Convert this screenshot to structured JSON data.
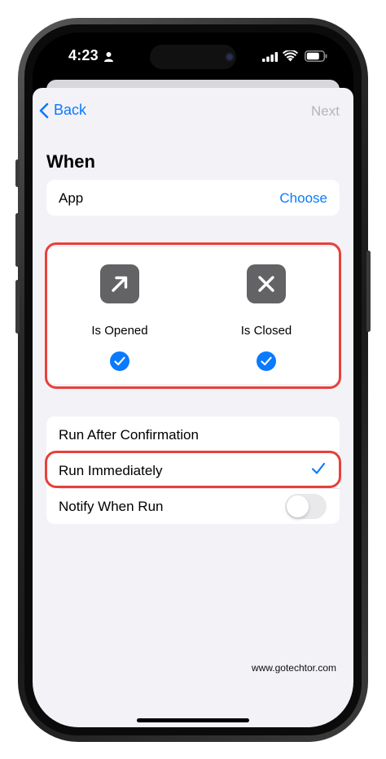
{
  "status_bar": {
    "time": "4:23"
  },
  "nav": {
    "back_label": "Back",
    "next_label": "Next"
  },
  "section": {
    "title": "When"
  },
  "app_row": {
    "label": "App",
    "value": "Choose"
  },
  "triggers": [
    {
      "label": "Is Opened",
      "icon": "arrow-up-right-icon",
      "checked": true
    },
    {
      "label": "Is Closed",
      "icon": "x-mark-icon",
      "checked": true
    }
  ],
  "options": [
    {
      "label": "Run After Confirmation",
      "selected": false
    },
    {
      "label": "Run Immediately",
      "selected": true
    },
    {
      "label": "Notify When Run",
      "toggle": false
    }
  ],
  "watermark": "www.gotechtor.com",
  "colors": {
    "accent": "#0a7aff",
    "highlight": "#e8403a",
    "tile": "#636366",
    "background": "#f2f2f7"
  }
}
